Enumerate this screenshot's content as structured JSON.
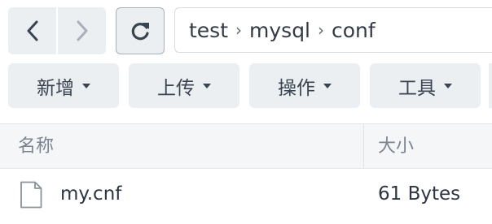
{
  "path": {
    "segments": [
      "test",
      "mysql",
      "conf"
    ],
    "separator": "›"
  },
  "toolbar": {
    "buttons": [
      "新增",
      "上传",
      "操作",
      "工具"
    ]
  },
  "table": {
    "columns": [
      "名称",
      "大小"
    ],
    "rows": [
      {
        "name": "my.cnf",
        "size": "61 Bytes",
        "icon": "file-icon"
      }
    ]
  },
  "colors": {
    "button_bg": "#eceff2",
    "header_bg": "#f4f6f8",
    "text": "#333b45"
  }
}
